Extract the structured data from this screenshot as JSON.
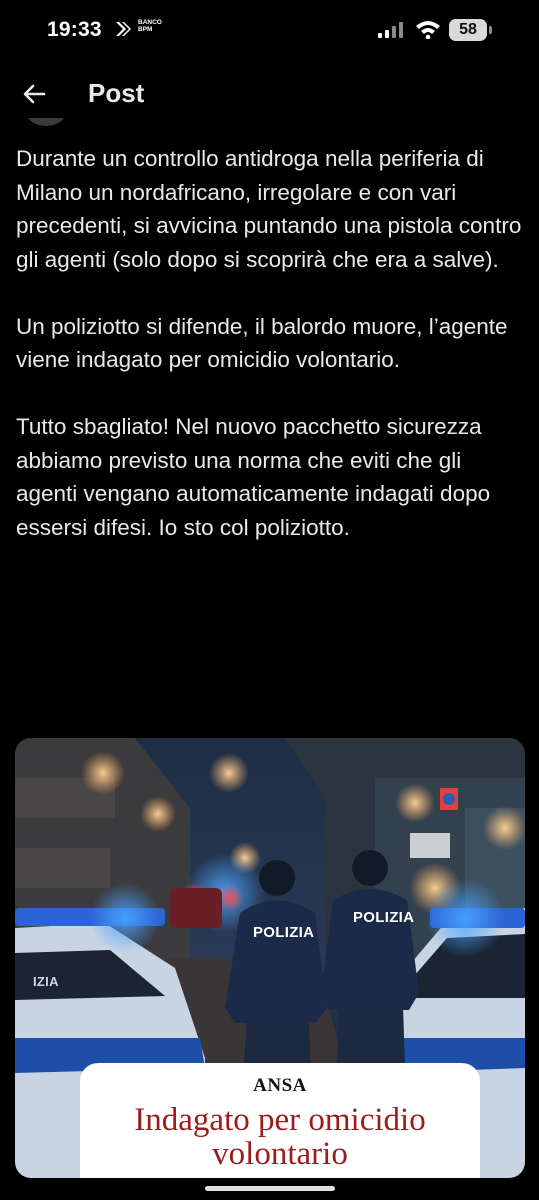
{
  "status_bar": {
    "time": "19:33",
    "bank_label_line1": "BANCO",
    "bank_label_line2": "BPM",
    "battery": "58",
    "battery_level": 0.58
  },
  "header": {
    "back_icon": "arrow-left-icon",
    "title": "Post"
  },
  "post": {
    "paragraphs": [
      "Durante un controllo antidroga nella periferia di Milano un nordafricano, irregolare e con vari precedenti, si avvicina puntando una pistola contro gli agenti (solo dopo si scoprirà che era a salve).",
      "Un poliziotto si difende, il balordo muore, l’agente viene indagato per omicidio volontario.",
      "Tutto sbagliato! Nel nuovo pacchetto sicurezza abbiamo previsto una norma che eviti che gli agenti vengano automaticamente indagati dopo essersi difesi. Io sto col poliziotto."
    ]
  },
  "media": {
    "officer_left_label": "POLIZIA",
    "officer_right_label": "POLIZIA",
    "car_label": "IZIA",
    "card": {
      "source": "ANSA",
      "headline_line1": "Indagato per omicidio",
      "headline_line2": "volontario"
    }
  },
  "colors": {
    "background": "#000000",
    "text": "#e7e9ea",
    "headline_red": "#9c1b1b"
  }
}
